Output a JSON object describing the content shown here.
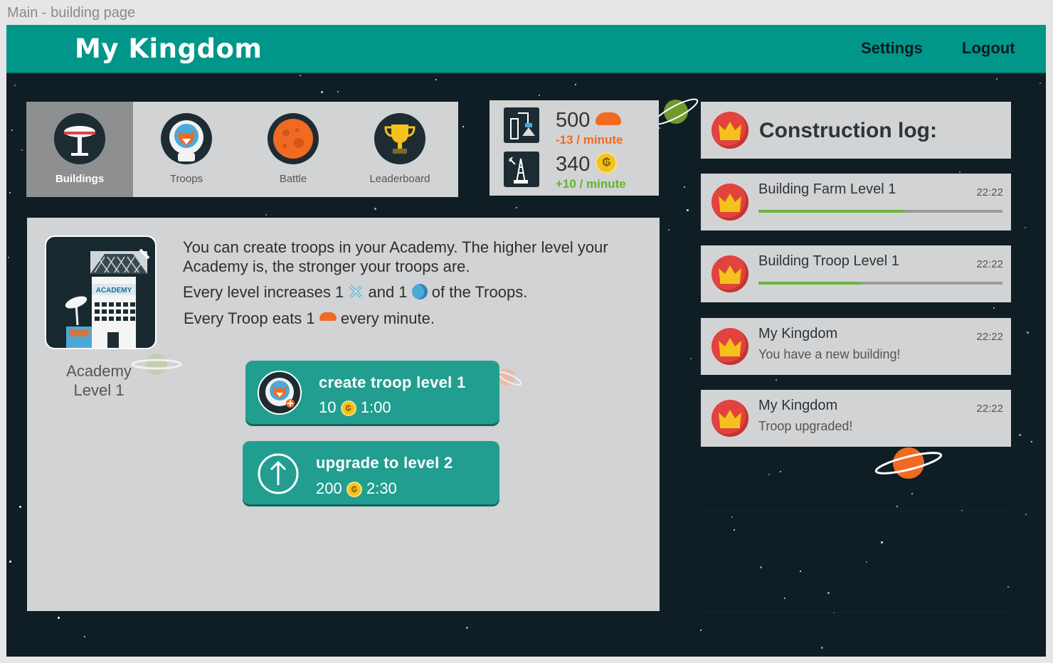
{
  "frame": {
    "title": "Main - building page"
  },
  "header": {
    "brand": "My Kingdom",
    "settings_label": "Settings",
    "logout_label": "Logout",
    "color": "#00968a"
  },
  "tabs": [
    {
      "label": "Buildings",
      "icon": "building-icon",
      "active": true
    },
    {
      "label": "Troops",
      "icon": "astronaut-fox-icon",
      "active": false
    },
    {
      "label": "Battle",
      "icon": "planet-icon",
      "active": false
    },
    {
      "label": "Leaderboard",
      "icon": "trophy-icon",
      "active": false
    }
  ],
  "resources": {
    "food": {
      "amount": "500",
      "rate": "-13 / minute",
      "icon": "bread-icon",
      "rate_color": "#f26b21"
    },
    "gold": {
      "amount": "340",
      "rate": "+10 / minute",
      "icon": "coin-icon",
      "rate_color": "#66b132"
    }
  },
  "building": {
    "name": "Academy",
    "level": "Level 1",
    "sign": "ACADEMY",
    "description_1": "You can create troops in your Academy. The higher level  your",
    "description_2": "Academy is, the stronger your troops are.",
    "levels_text_a": "Every level increases 1",
    "levels_text_b": "and 1",
    "levels_text_c": "of the Troops.",
    "eats_text_a": "Every Troop eats 1",
    "eats_text_b": "every minute."
  },
  "actions": {
    "create": {
      "title": "create troop level 1",
      "cost": "10",
      "time": "1:00"
    },
    "upgrade": {
      "title": "upgrade to level 2",
      "cost": "200",
      "time": "2:30"
    }
  },
  "log": {
    "title": "Construction log:",
    "items": [
      {
        "title": "Building Farm Level 1",
        "time": "22:22",
        "progress": 0.6
      },
      {
        "title": "Building Troop Level 1",
        "time": "22:22",
        "progress": 0.42
      },
      {
        "title": "My Kingdom",
        "subtitle": "You have a new building!",
        "time": "22:22"
      },
      {
        "title": "My Kingdom",
        "subtitle": "Troop upgraded!",
        "time": "22:22"
      }
    ]
  },
  "coin_symbol": "₲"
}
